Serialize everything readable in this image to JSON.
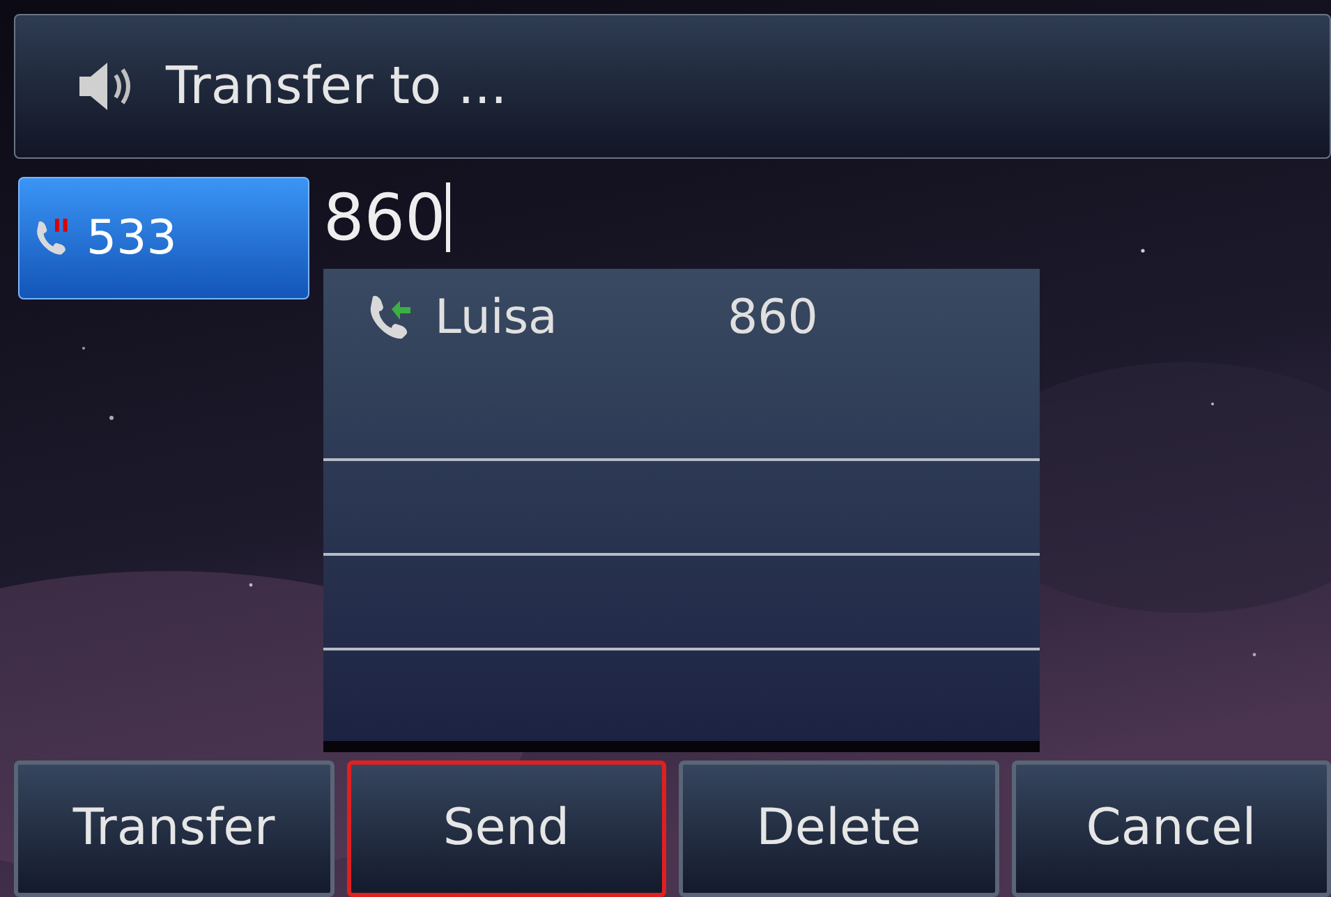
{
  "header": {
    "title": "Transfer to ..."
  },
  "lines": [
    {
      "number": "533",
      "selected": true,
      "held": true
    }
  ],
  "input": {
    "value": "860"
  },
  "suggestions": [
    {
      "name": "Luisa",
      "number": "860"
    }
  ],
  "softkeys": [
    {
      "label": "Transfer",
      "selected": false
    },
    {
      "label": "Send",
      "selected": true
    },
    {
      "label": "Delete",
      "selected": false
    },
    {
      "label": "Cancel",
      "selected": false
    }
  ]
}
